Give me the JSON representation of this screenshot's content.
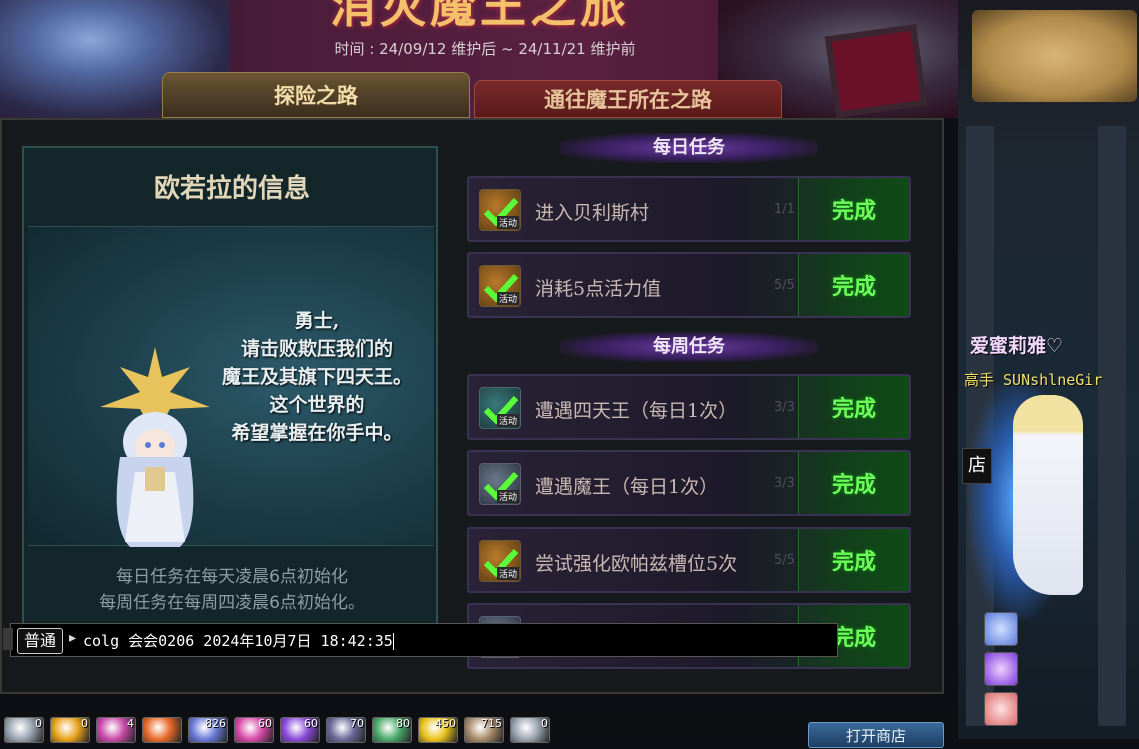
{
  "banner": {
    "title": "消灭魔王之旅",
    "period": "时间 : 24/09/12 维护后 ~ 24/11/21 维护前"
  },
  "tabs": [
    {
      "label": "探险之路",
      "active": true
    },
    {
      "label": "通往魔王所在之路",
      "active": false
    }
  ],
  "info": {
    "title": "欧若拉的信息",
    "message": [
      "勇士,",
      "请击败欺压我们的",
      "魔王及其旗下四天王。",
      "这个世界的",
      "希望掌握在你手中。"
    ],
    "reset_notes": [
      "每日任务在每天凌晨6点初始化",
      "每周任务在每周四凌晨6点初始化。"
    ]
  },
  "daily": {
    "header": "每日任务",
    "quests": [
      {
        "name": "进入贝利斯村",
        "progress": "1/1",
        "status": "完成",
        "icon": "checkmark-icon",
        "tag": "活动"
      },
      {
        "name": "消耗5点活力值",
        "progress": "5/5",
        "status": "完成",
        "icon": "checkmark-icon",
        "tag": "活动"
      }
    ]
  },
  "weekly": {
    "header": "每周任务",
    "quests": [
      {
        "name": "遭遇四天王（每日1次）",
        "progress": "3/3",
        "status": "完成",
        "icon": "checkmark-icon",
        "tag": "活动"
      },
      {
        "name": "遭遇魔王（每日1次）",
        "progress": "3/3",
        "status": "完成",
        "icon": "checkmark-icon",
        "tag": "活动"
      },
      {
        "name": "尝试强化欧帕兹槽位5次",
        "progress": "5/5",
        "status": "完成",
        "icon": "checkmark-icon",
        "tag": "活动"
      },
      {
        "name": "",
        "progress": "",
        "status": "完成",
        "icon": "checkmark-icon",
        "tag": ""
      }
    ]
  },
  "chat": {
    "channel": "普通",
    "input_value": "colg 会会0206 2024年10月7日 18:42:35"
  },
  "skillbar": [
    {
      "count": "0",
      "color": "#9aa4b0"
    },
    {
      "count": "0",
      "color": "#e8a21a"
    },
    {
      "count": "4",
      "color": "#c84aa8"
    },
    {
      "count": "",
      "color": "#e86a2a"
    },
    {
      "count": "826",
      "color": "#6a7ad8"
    },
    {
      "count": "60",
      "color": "#d84aa8"
    },
    {
      "count": "60",
      "color": "#8a4ad8"
    },
    {
      "count": "70",
      "color": "#6a6a9a"
    },
    {
      "count": "80",
      "color": "#4aa86a"
    },
    {
      "count": "450",
      "color": "#e8c21a"
    },
    {
      "count": "715",
      "color": "#a88a6a"
    },
    {
      "count": "0",
      "color": "#9aa4b0"
    }
  ],
  "shop_button": "打开商店",
  "game": {
    "player_name": "爱蜜莉雅♡",
    "player_title": "高手 SUNshlneGir",
    "npc_label": "店"
  },
  "colors": {
    "complete_green": "#6cff5a",
    "gold": "#f4c06a"
  }
}
